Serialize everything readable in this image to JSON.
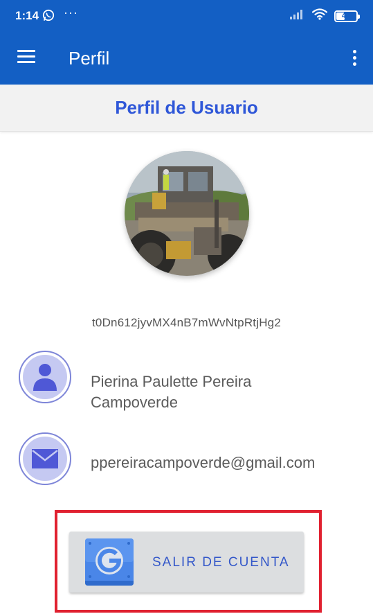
{
  "status_bar": {
    "time": "1:14",
    "dots": "···",
    "battery_level": "44"
  },
  "app_bar": {
    "title": "Perfil"
  },
  "profile": {
    "header": "Perfil de Usuario",
    "uid": "t0Dn612jyvMX4nB7mWvNtpRtjHg2",
    "name_line1": "Pierina Paulette Pereira",
    "name_line2": "Campoverde",
    "email": "ppereiracampoverde@gmail.com"
  },
  "logout": {
    "label": "SALIR DE CUENTA",
    "icon": "google-g-icon"
  },
  "colors": {
    "primary": "#135fc4",
    "title_blue": "#2f57d8",
    "icon_bg": "#c5c9f2",
    "icon_fg": "#4f58d6",
    "highlight_red": "#e02130",
    "button_bg": "#dcdee0"
  }
}
